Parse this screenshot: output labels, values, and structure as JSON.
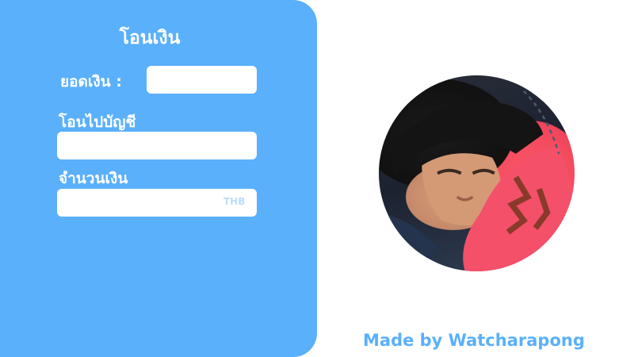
{
  "transfer_panel": {
    "title": "โอนเงิน",
    "balance_label": "ยอดเงิน :",
    "balance_value": "",
    "recipient_label": "โอนไปบัญชี",
    "recipient_value": "",
    "amount_label": "จำนวนเงิน",
    "amount_value": "",
    "currency": "THB"
  },
  "profile": {
    "avatar": "user-photo"
  },
  "footer": {
    "credit": "Made by Watcharapong"
  },
  "colors": {
    "accent": "#5ab0fb",
    "panel_text": "#ffffff",
    "currency_text": "#bcdcfb"
  }
}
